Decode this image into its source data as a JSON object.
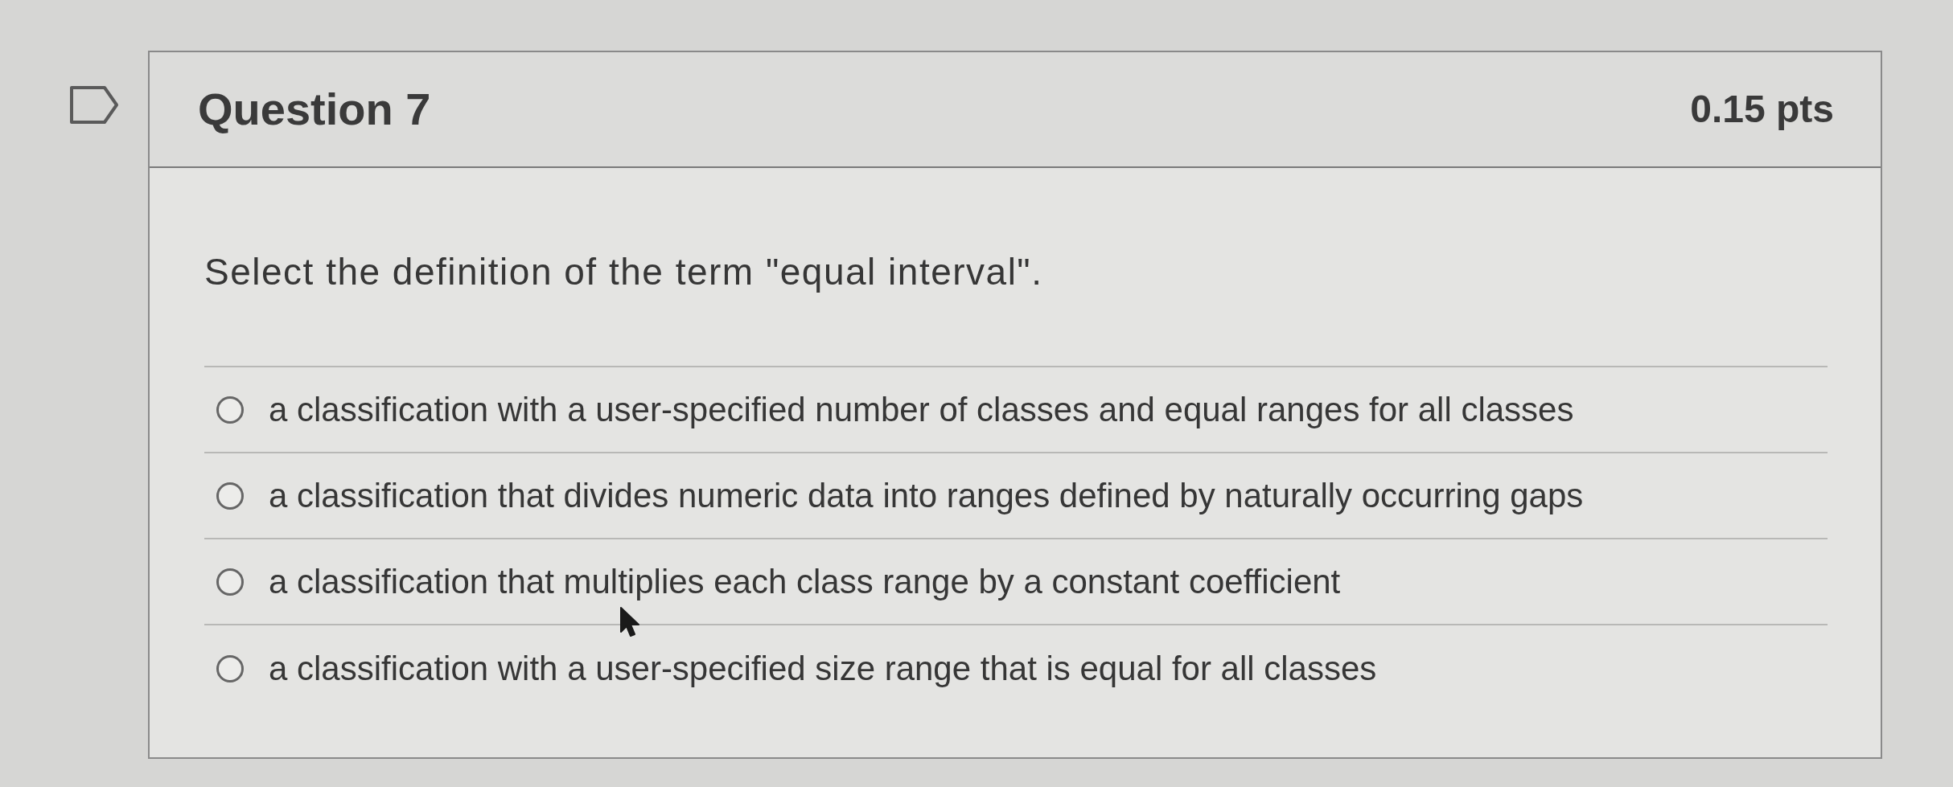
{
  "question": {
    "title": "Question 7",
    "points": "0.15 pts",
    "text": "Select the definition of the term \"equal interval\".",
    "options": [
      {
        "label": "a classification with a user-specified number of classes and equal ranges for all classes",
        "selected": false
      },
      {
        "label": "a classification that divides numeric data into ranges defined by naturally occurring gaps",
        "selected": false
      },
      {
        "label": "a classification that multiplies each class range by a constant coefficient",
        "selected": false
      },
      {
        "label": "a classification with a user-specified size range that is equal for all classes",
        "selected": false
      }
    ]
  }
}
